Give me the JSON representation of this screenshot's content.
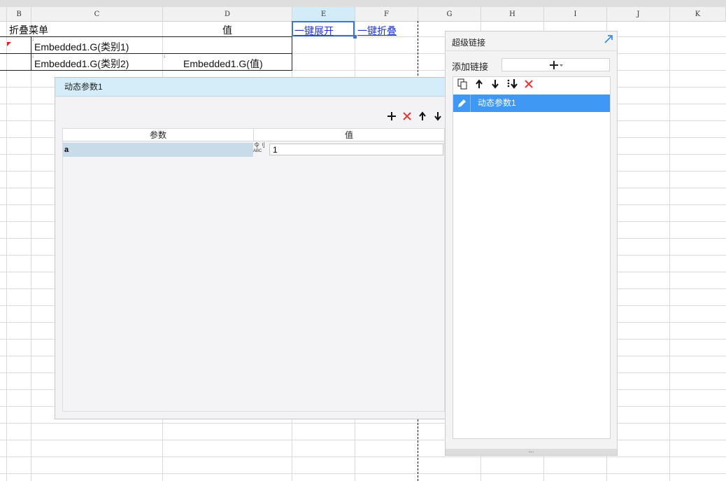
{
  "columns": [
    "B",
    "C",
    "D",
    "E",
    "F",
    "G",
    "H",
    "I",
    "J",
    "K"
  ],
  "selected_column": "E",
  "cells": {
    "b1": "折叠菜单",
    "d1": "值",
    "e1": "一键展开",
    "f1": "一键折叠",
    "c2": "Embedded1.G(类别1)",
    "c3": "Embedded1.G(类别2)",
    "d3": "Embedded1.G(值)"
  },
  "dialog": {
    "title": "动态参数1",
    "table": {
      "headers": [
        "参数",
        "值"
      ],
      "rows": [
        {
          "param": "a",
          "type_top": "令刂",
          "type_bottom": "ABC",
          "value": "1"
        }
      ]
    },
    "icons": [
      "add-icon",
      "delete-icon",
      "move-up-icon",
      "move-down-icon"
    ]
  },
  "panel": {
    "title": "超级链接",
    "add_label": "添加链接",
    "items": [
      {
        "label": "动态参数1"
      }
    ],
    "icons": [
      "copy-icon",
      "move-up-icon",
      "move-down-icon",
      "move-bottom-icon",
      "delete-icon"
    ],
    "footer": "..."
  },
  "colors": {
    "link": "#1e34d6",
    "accent": "#3f98f4",
    "title_bg": "#d4edf9",
    "delete": "#e53935"
  }
}
